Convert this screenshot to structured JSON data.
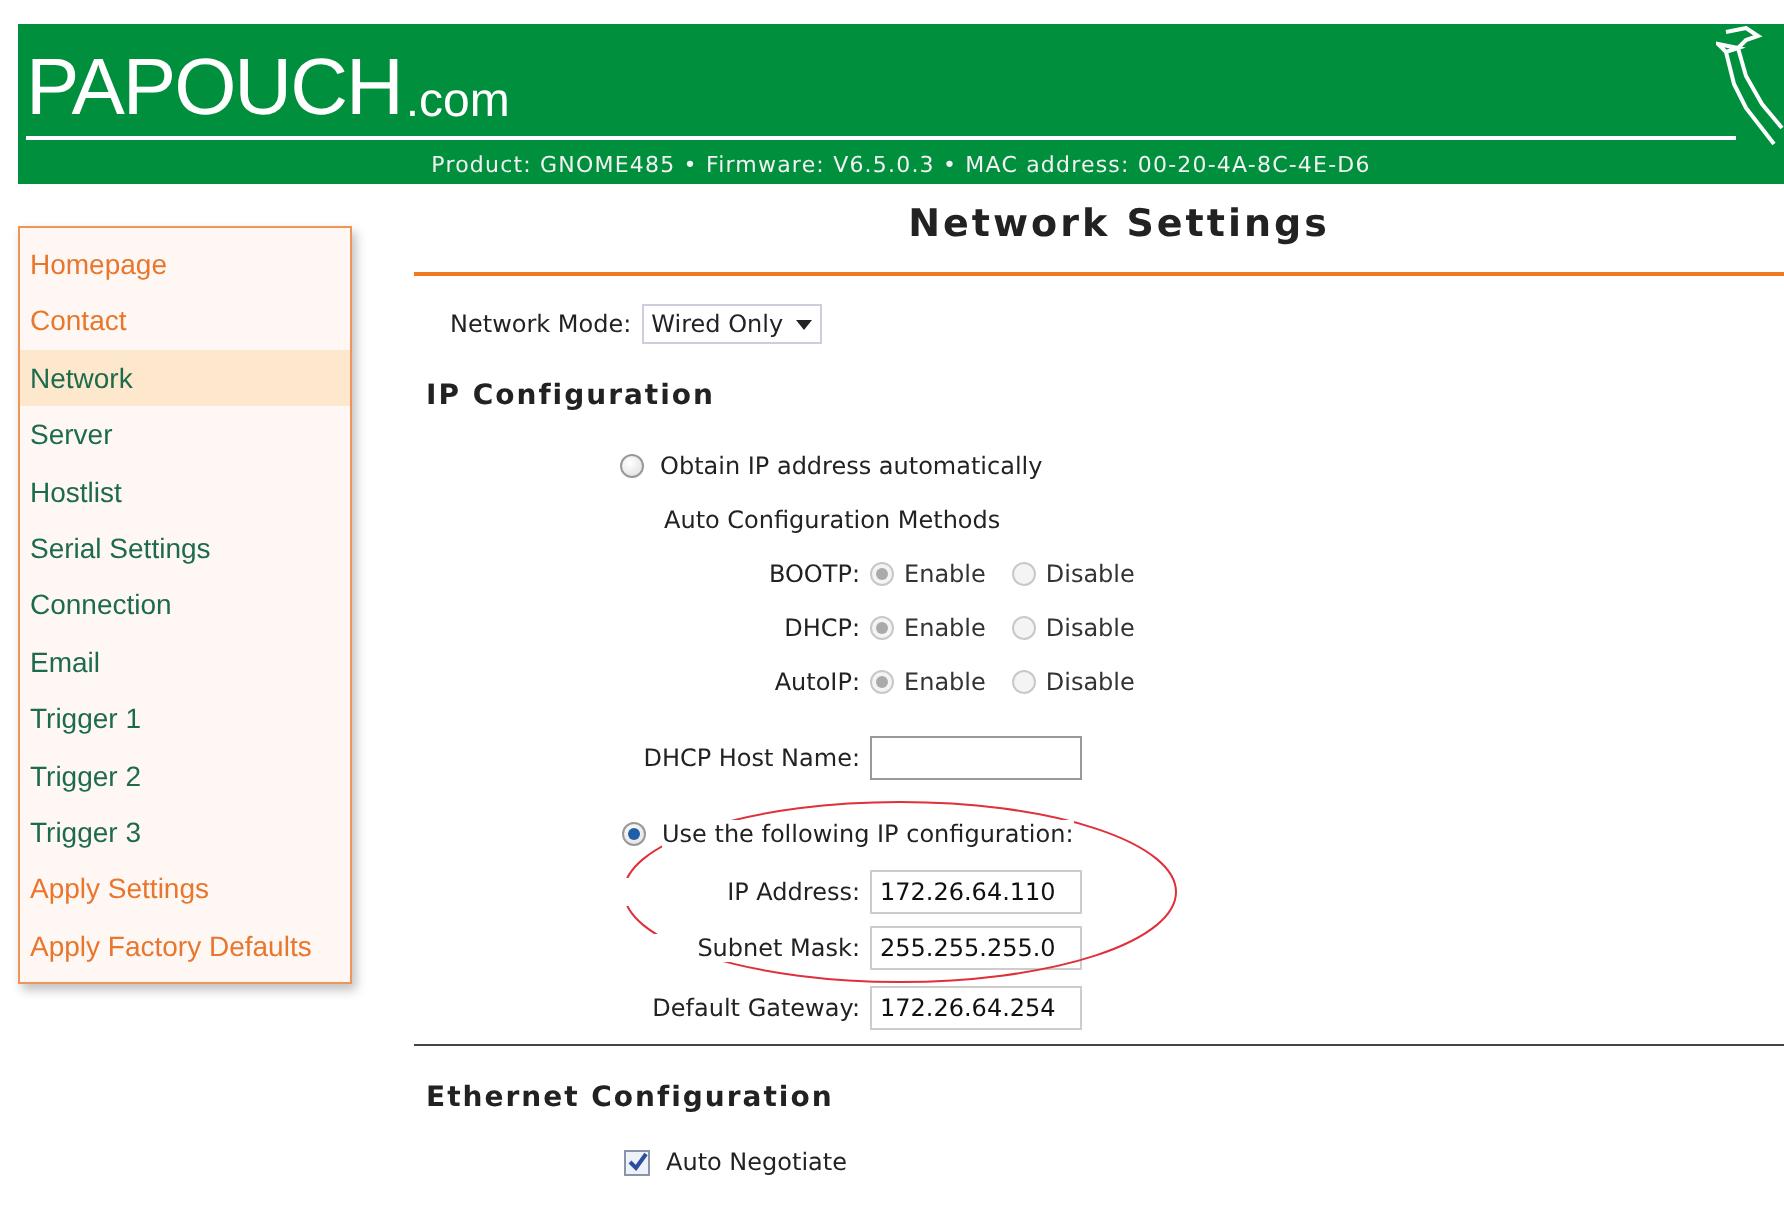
{
  "header": {
    "logo": "PAPOUCH",
    "logo_suffix": ".com",
    "info": "Product: GNOME485 • Firmware: V6.5.0.3 • MAC address: 00-20-4A-8C-4E-D6"
  },
  "sidebar": {
    "items": [
      {
        "label": "Homepage",
        "color": "#e8762c",
        "selected": false
      },
      {
        "label": "Contact",
        "color": "#e8762c",
        "selected": false
      },
      {
        "label": "Network",
        "color": "#1d6b4c",
        "selected": true
      },
      {
        "label": "Server",
        "color": "#1d6b4c",
        "selected": false
      },
      {
        "label": "Hostlist",
        "color": "#1d6b4c",
        "selected": false
      },
      {
        "label": "Serial Settings",
        "color": "#1d6b4c",
        "selected": false
      },
      {
        "label": "Connection",
        "color": "#1d6b4c",
        "selected": false
      },
      {
        "label": "Email",
        "color": "#1d6b4c",
        "selected": false
      },
      {
        "label": "Trigger 1",
        "color": "#1d6b4c",
        "selected": false
      },
      {
        "label": "Trigger 2",
        "color": "#1d6b4c",
        "selected": false
      },
      {
        "label": "Trigger 3",
        "color": "#1d6b4c",
        "selected": false
      },
      {
        "label": "Apply Settings",
        "color": "#e8762c",
        "selected": false
      },
      {
        "label": "Apply Factory Defaults",
        "color": "#e8762c",
        "selected": false
      }
    ]
  },
  "title": "Network Settings",
  "network_mode": {
    "label": "Network Mode:",
    "value": "Wired Only"
  },
  "ip_configuration": {
    "heading": "IP Configuration",
    "obtain_auto": {
      "label": "Obtain IP address automatically",
      "selected": false
    },
    "auto_methods": {
      "title": "Auto Configuration Methods",
      "disabled": true,
      "rows": [
        {
          "label": "BOOTP:",
          "options": [
            {
              "label": "Enable",
              "selected": true
            },
            {
              "label": "Disable",
              "selected": false
            }
          ]
        },
        {
          "label": "DHCP:",
          "options": [
            {
              "label": "Enable",
              "selected": true
            },
            {
              "label": "Disable",
              "selected": false
            }
          ]
        },
        {
          "label": "AutoIP:",
          "options": [
            {
              "label": "Enable",
              "selected": true
            },
            {
              "label": "Disable",
              "selected": false
            }
          ]
        }
      ]
    },
    "host_name": {
      "label": "DHCP Host Name:"
    },
    "use_static": {
      "label": "Use the following IP configuration:",
      "selected": true
    },
    "static_fields": [
      {
        "label": "IP Address:",
        "value": "172.26.64.110"
      },
      {
        "label": "Subnet Mask:",
        "value": "255.255.255.0"
      },
      {
        "label": "Default Gateway:",
        "value": "172.26.64.254"
      }
    ]
  },
  "ethernet_configuration": {
    "heading": "Ethernet Configuration",
    "auto_negotiate": {
      "label": "Auto Negotiate",
      "checked": true
    }
  }
}
